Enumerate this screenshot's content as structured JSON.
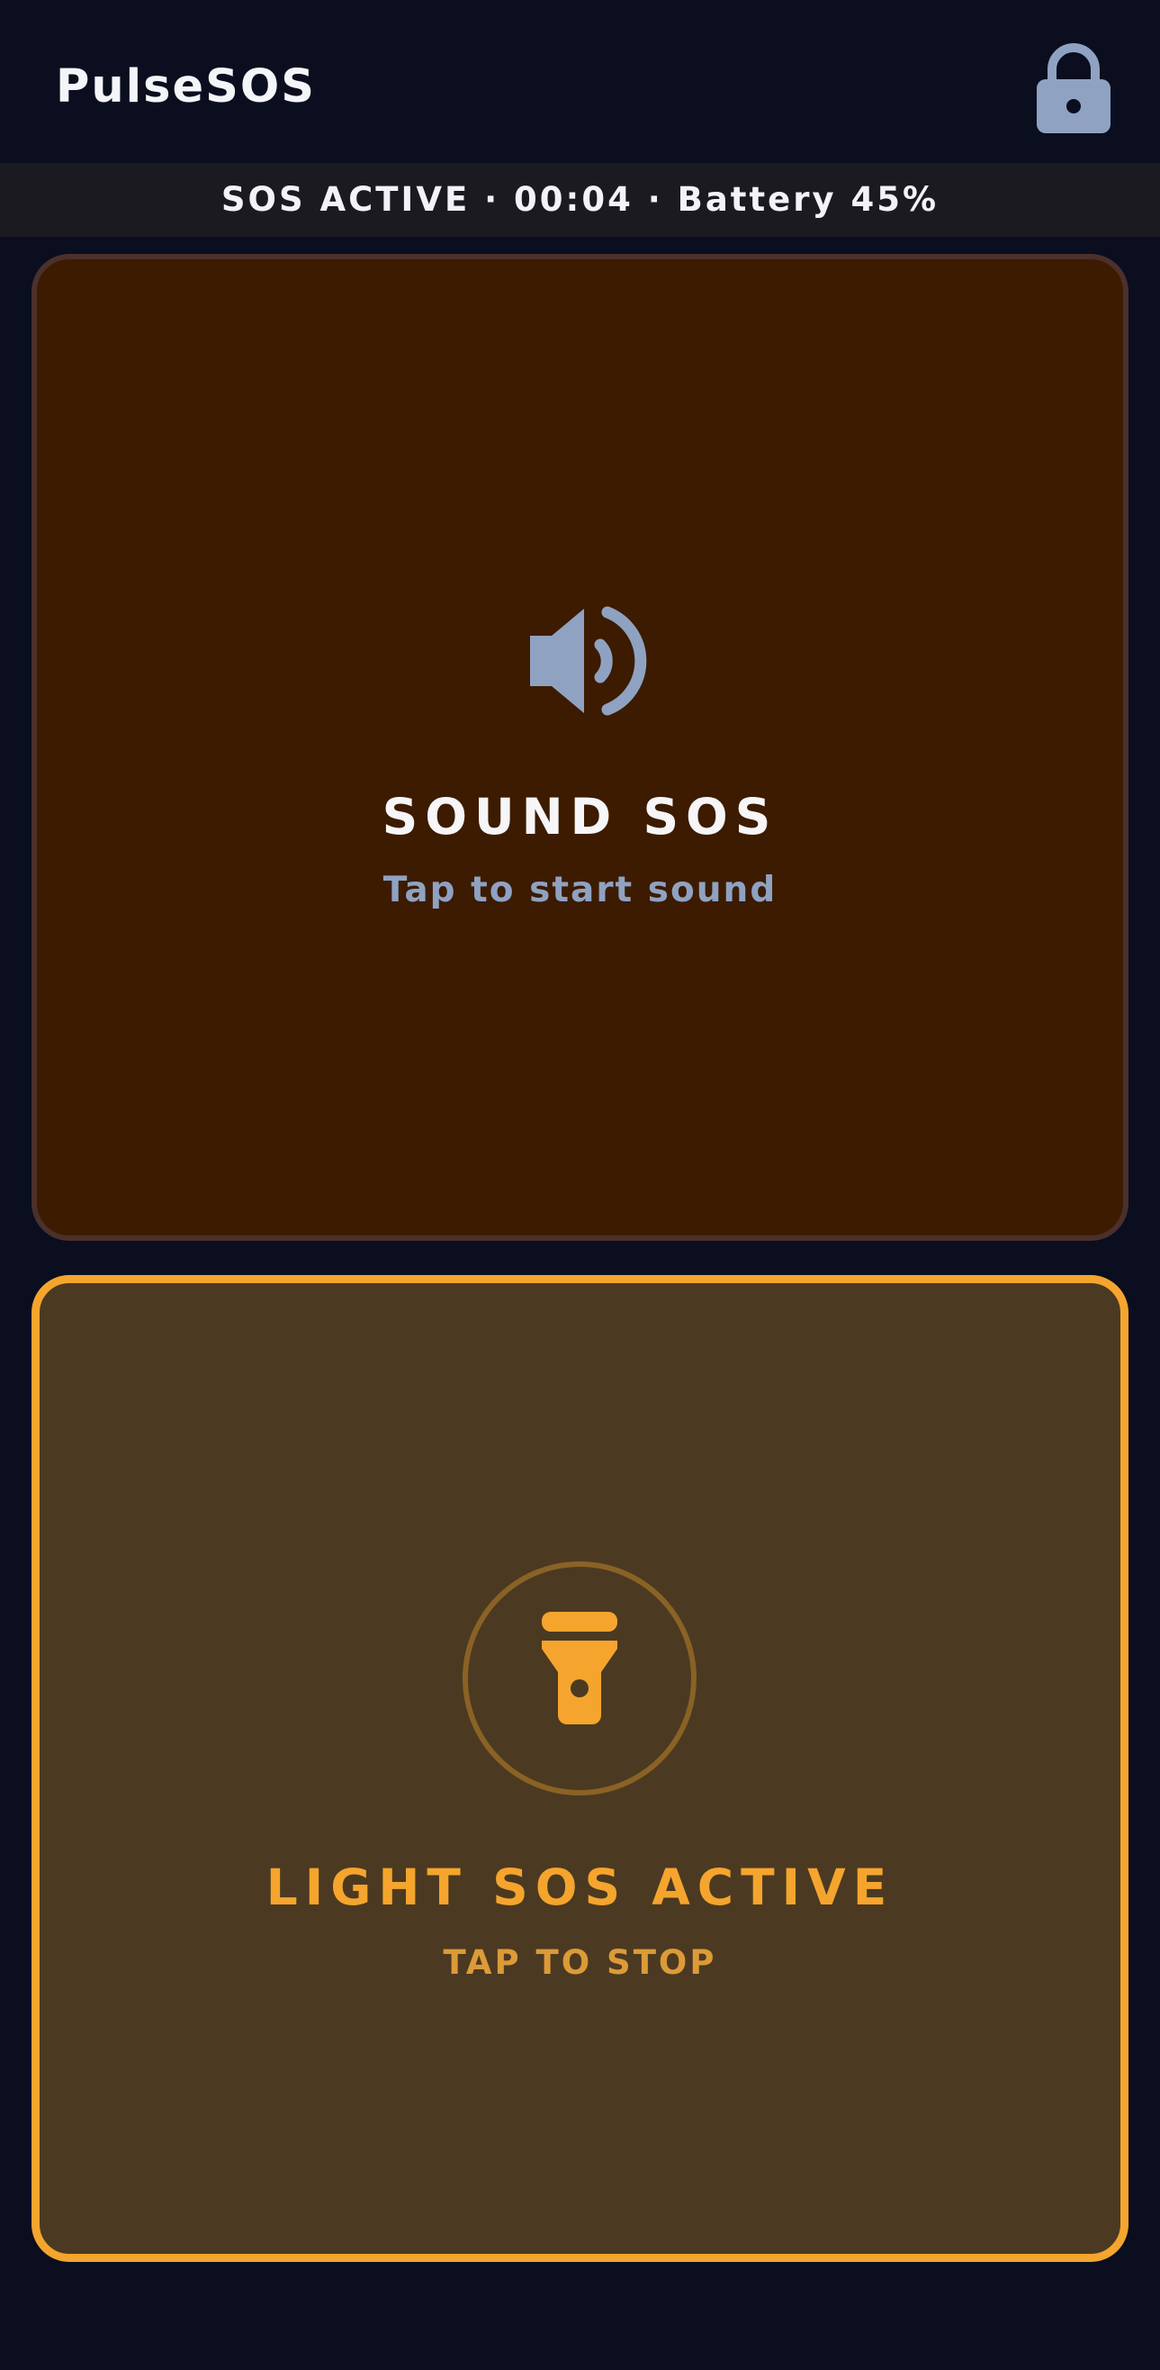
{
  "header": {
    "app_title": "PulseSOS",
    "lock_icon": "lock-icon"
  },
  "status": {
    "text": "SOS ACTIVE · 00:04 · Battery 45%"
  },
  "sound_card": {
    "icon": "speaker-icon",
    "title": "SOUND SOS",
    "subtitle": "Tap to start sound"
  },
  "light_card": {
    "icon": "flashlight-icon",
    "title": "LIGHT SOS ACTIVE",
    "subtitle": "TAP TO STOP"
  },
  "colors": {
    "background": "#0a0e1f",
    "accent": "#f4a52d",
    "muted_blue": "#8fa2c2"
  }
}
